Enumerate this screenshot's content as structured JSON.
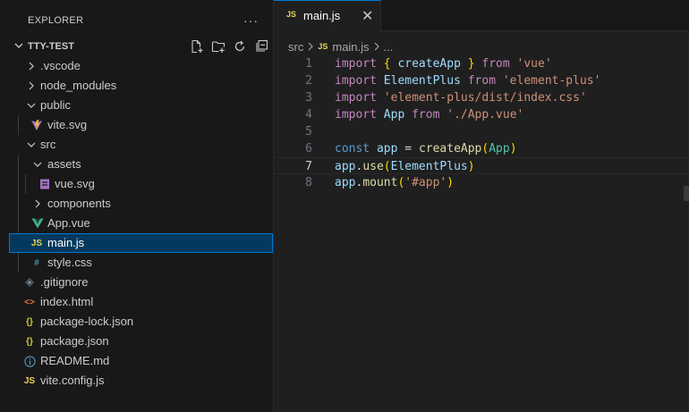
{
  "explorer": {
    "title": "EXPLORER",
    "more": "···",
    "root": "TTY-TEST",
    "actions": [
      "new-file-icon",
      "new-folder-icon",
      "refresh-icon",
      "collapse-all-icon"
    ]
  },
  "tree": [
    {
      "label": ".vscode",
      "kind": "folder",
      "expanded": false
    },
    {
      "label": "node_modules",
      "kind": "folder",
      "expanded": false
    },
    {
      "label": "public",
      "kind": "folder",
      "expanded": true
    },
    {
      "label": "vite.svg",
      "kind": "file",
      "icon": "vite-icon"
    },
    {
      "label": "src",
      "kind": "folder",
      "expanded": true
    },
    {
      "label": "assets",
      "kind": "folder",
      "expanded": true
    },
    {
      "label": "vue.svg",
      "kind": "file",
      "icon": "svg-icon"
    },
    {
      "label": "components",
      "kind": "folder",
      "expanded": false
    },
    {
      "label": "App.vue",
      "kind": "file",
      "icon": "vue-icon"
    },
    {
      "label": "main.js",
      "kind": "file",
      "icon": "js-icon",
      "selected": true
    },
    {
      "label": "style.css",
      "kind": "file",
      "icon": "css-icon"
    },
    {
      "label": ".gitignore",
      "kind": "file",
      "icon": "git-icon"
    },
    {
      "label": "index.html",
      "kind": "file",
      "icon": "html-icon"
    },
    {
      "label": "package-lock.json",
      "kind": "file",
      "icon": "json-icon"
    },
    {
      "label": "package.json",
      "kind": "file",
      "icon": "json-icon"
    },
    {
      "label": "README.md",
      "kind": "file",
      "icon": "info-icon"
    },
    {
      "label": "vite.config.js",
      "kind": "file",
      "icon": "js-icon"
    }
  ],
  "icons": {
    "js": "JS",
    "json": "{}",
    "css": "#",
    "html": "<>",
    "info": "ⓘ",
    "vue": "▼"
  },
  "editor": {
    "tab": {
      "label": "main.js",
      "close": "✕"
    },
    "breadcrumb": [
      "src",
      "main.js",
      "..."
    ],
    "active_line": 7,
    "lines": [
      {
        "n": "1",
        "code": "import { createApp } from 'vue'"
      },
      {
        "n": "2",
        "code": "import ElementPlus from 'element-plus'"
      },
      {
        "n": "3",
        "code": "import 'element-plus/dist/index.css'"
      },
      {
        "n": "4",
        "code": "import App from './App.vue'"
      },
      {
        "n": "5",
        "code": ""
      },
      {
        "n": "6",
        "code": "const app = createApp(App)"
      },
      {
        "n": "7",
        "code": "app.use(ElementPlus)"
      },
      {
        "n": "8",
        "code": "app.mount('#app')"
      }
    ]
  },
  "colors": {
    "accent": "#0078d4",
    "selection": "#04395e",
    "js": "#e8d44d",
    "vue": "#41b883"
  }
}
